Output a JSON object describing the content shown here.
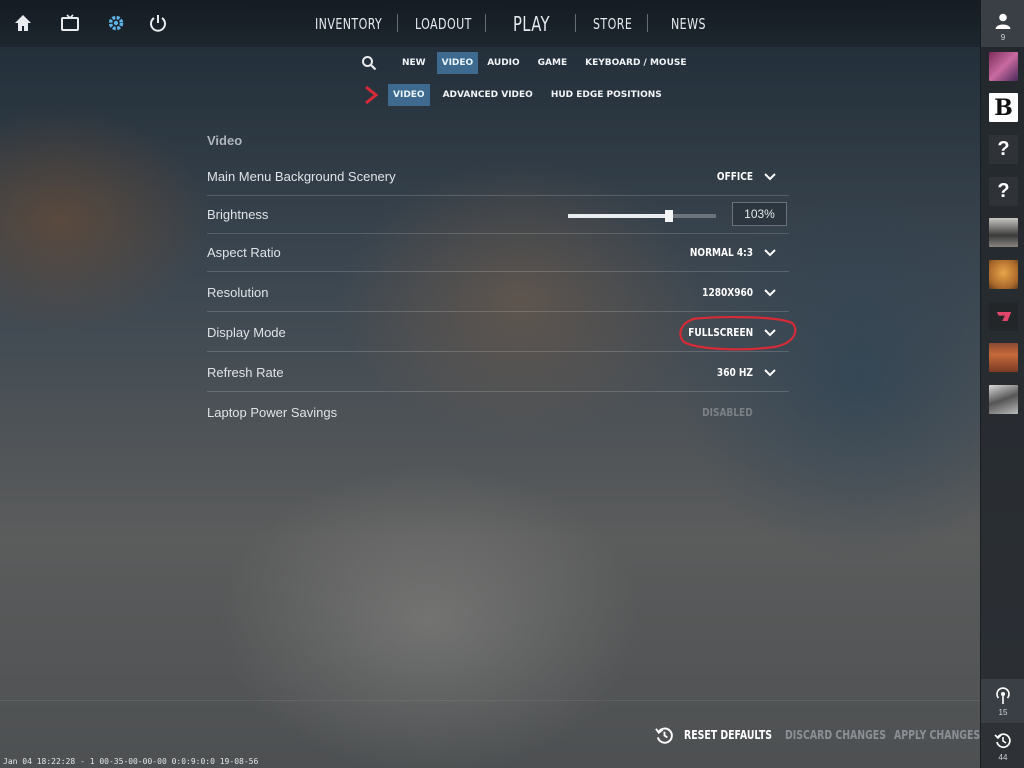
{
  "nav": {
    "items": [
      "INVENTORY",
      "LOADOUT",
      "PLAY",
      "STORE",
      "NEWS"
    ],
    "icons": [
      "home-icon",
      "tv-icon",
      "gear-icon",
      "power-icon"
    ],
    "accent": "#5fb2e6"
  },
  "tabs": {
    "primary": [
      "NEW",
      "VIDEO",
      "AUDIO",
      "GAME",
      "KEYBOARD / MOUSE"
    ],
    "primary_active": "VIDEO",
    "secondary": [
      "VIDEO",
      "ADVANCED VIDEO",
      "HUD EDGE POSITIONS"
    ],
    "secondary_active": "VIDEO",
    "active_color": "#3d6a8e"
  },
  "section": {
    "title": "Video",
    "rows": [
      {
        "label": "Main Menu Background Scenery",
        "value": "OFFICE"
      },
      {
        "label": "Brightness",
        "value": "103%",
        "slider_level": 0.68
      },
      {
        "label": "Aspect Ratio",
        "value": "NORMAL 4:3"
      },
      {
        "label": "Resolution",
        "value": "1280X960"
      },
      {
        "label": "Display Mode",
        "value": "FULLSCREEN"
      },
      {
        "label": "Refresh Rate",
        "value": "360 HZ"
      },
      {
        "label": "Laptop Power Savings",
        "value": "DISABLED"
      }
    ],
    "annotation_color": "#d62a36"
  },
  "sidebar": {
    "friends_count": "9",
    "avatars": [
      "avatar-pink-creature",
      "B",
      "?",
      "?",
      "avatar-person",
      "avatar-cat",
      "avatar-logo",
      "avatar-crowd",
      "avatar-car"
    ],
    "stream_count": "15",
    "history_count": "44"
  },
  "footer": {
    "reset": "RESET DEFAULTS",
    "discard": "DISCARD CHANGES",
    "apply": "APPLY CHANGES"
  },
  "status": "Jan 04 18:22:28 - 1 00-35-00-00-00 0:0:9:0:0 19-08-56"
}
